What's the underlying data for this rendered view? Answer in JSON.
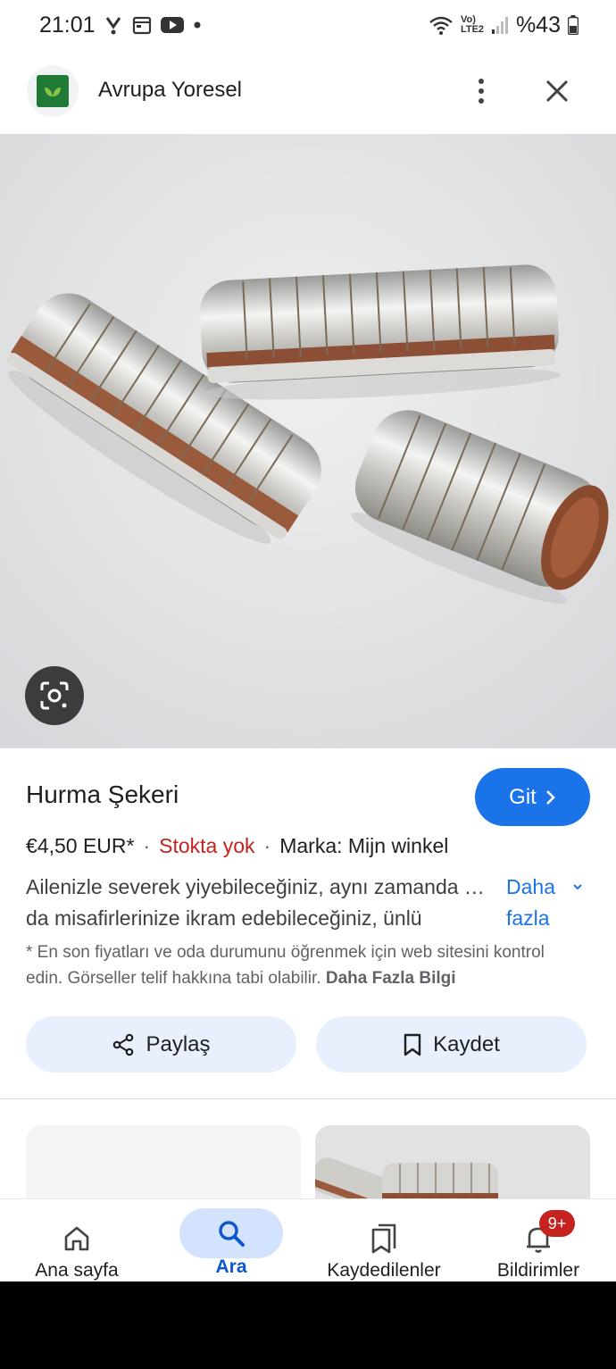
{
  "status_bar": {
    "time": "21:01",
    "network_label": "Vo) LTE2",
    "battery": "%43"
  },
  "header": {
    "site_name": "Avrupa Yoresel"
  },
  "product": {
    "title": "Hurma Şekeri",
    "go_button": "Git",
    "price": "€4,50 EUR*",
    "stock": "Stokta yok",
    "brand": "Marka: Mijn winkel",
    "description_line1": "Ailenizle severek yiyebileceğiniz, aynı zamanda da misafirlerinize ikram edebileceğiniz, ünlü",
    "description_line2": "da misafirlerinize ikram edebileceğiniz, ünlü",
    "more_link": "Daha fazla",
    "disclaimer": "* En son fiyatları ve oda durumunu öğrenmek için web sitesini kontrol edin. Görseller telif hakkına tabi olabilir.",
    "disclaimer_link": "Daha Fazla Bilgi",
    "share_label": "Paylaş",
    "save_label": "Kaydet"
  },
  "bottom_nav": {
    "home": "Ana sayfa",
    "search": "Ara",
    "saved": "Kaydedilenler",
    "notifications": "Bildirimler",
    "badge": "9+"
  },
  "colors": {
    "accent": "#1a73e8",
    "stock_out": "#c5221f",
    "pill_bg": "#e8f0fe"
  },
  "icons": [
    "search-icon",
    "home-icon",
    "bookmarks-icon",
    "bell-icon",
    "share-icon",
    "bookmark-icon",
    "lens-icon",
    "close-icon",
    "more-vert-icon",
    "chevron-right-icon",
    "chevron-down-icon"
  ]
}
